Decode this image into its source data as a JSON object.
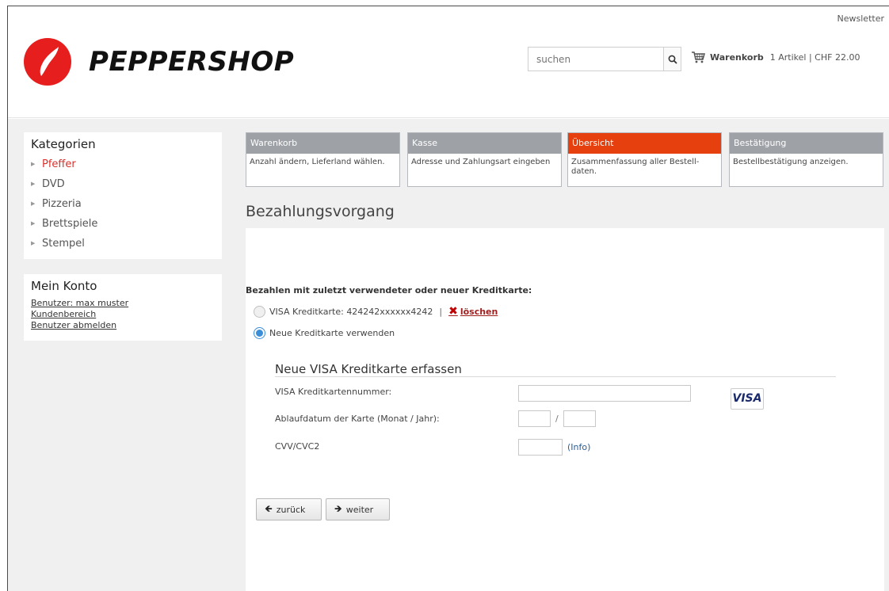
{
  "header": {
    "newsletter": "Newsletter",
    "logo_text": "PEPPERSHOP",
    "brand_color": "#e61e1e",
    "search_placeholder": "suchen",
    "cart_label": "Warenkorb",
    "cart_info": "1 Artikel | CHF 22.00"
  },
  "sidebar": {
    "categories_title": "Kategorien",
    "categories": [
      {
        "label": "Pfeffer",
        "active": true
      },
      {
        "label": "DVD",
        "active": false
      },
      {
        "label": "Pizzeria",
        "active": false
      },
      {
        "label": "Brettspiele",
        "active": false
      },
      {
        "label": "Stempel",
        "active": false
      }
    ],
    "account_title": "Mein Konto",
    "account_links": [
      "Benutzer: max muster",
      "Kundenbereich",
      "Benutzer abmelden"
    ]
  },
  "steps": [
    {
      "title": "Warenkorb",
      "desc": "Anzahl ändern, Lieferland wählen.",
      "active": false
    },
    {
      "title": "Kasse",
      "desc": "Adresse und Zahlungsart eingeben",
      "active": false
    },
    {
      "title": "Übersicht",
      "desc": "Zusammenfassung aller Bestell-daten.",
      "active": true
    },
    {
      "title": "Bestätigung",
      "desc": "Bestellbestätigung anzeigen.",
      "active": false
    }
  ],
  "accent_color": "#e6400f",
  "page_title": "Bezahlungsvorgang",
  "payment": {
    "heading": "Bezahlen mit zuletzt verwendeter oder neuer Kreditkarte:",
    "saved_card": "VISA Kreditkarte: 424242xxxxxx4242",
    "separator": "|",
    "delete_label": "löschen",
    "new_card_option": "Neue Kreditkarte verwenden",
    "selected_option": "new_card"
  },
  "form": {
    "title": "Neue VISA Kreditkarte erfassen",
    "card_number_label": "VISA Kreditkartennummer:",
    "card_number_value": "",
    "expiry_label": "Ablaufdatum der Karte (Monat / Jahr):",
    "expiry_month": "",
    "expiry_year": "",
    "expiry_separator": "/",
    "cvv_label": "CVV/CVC2",
    "cvv_value": "",
    "info_link": "(Info)",
    "visa_logo": "VISA"
  },
  "buttons": {
    "back": "zurück",
    "next": "weiter"
  }
}
